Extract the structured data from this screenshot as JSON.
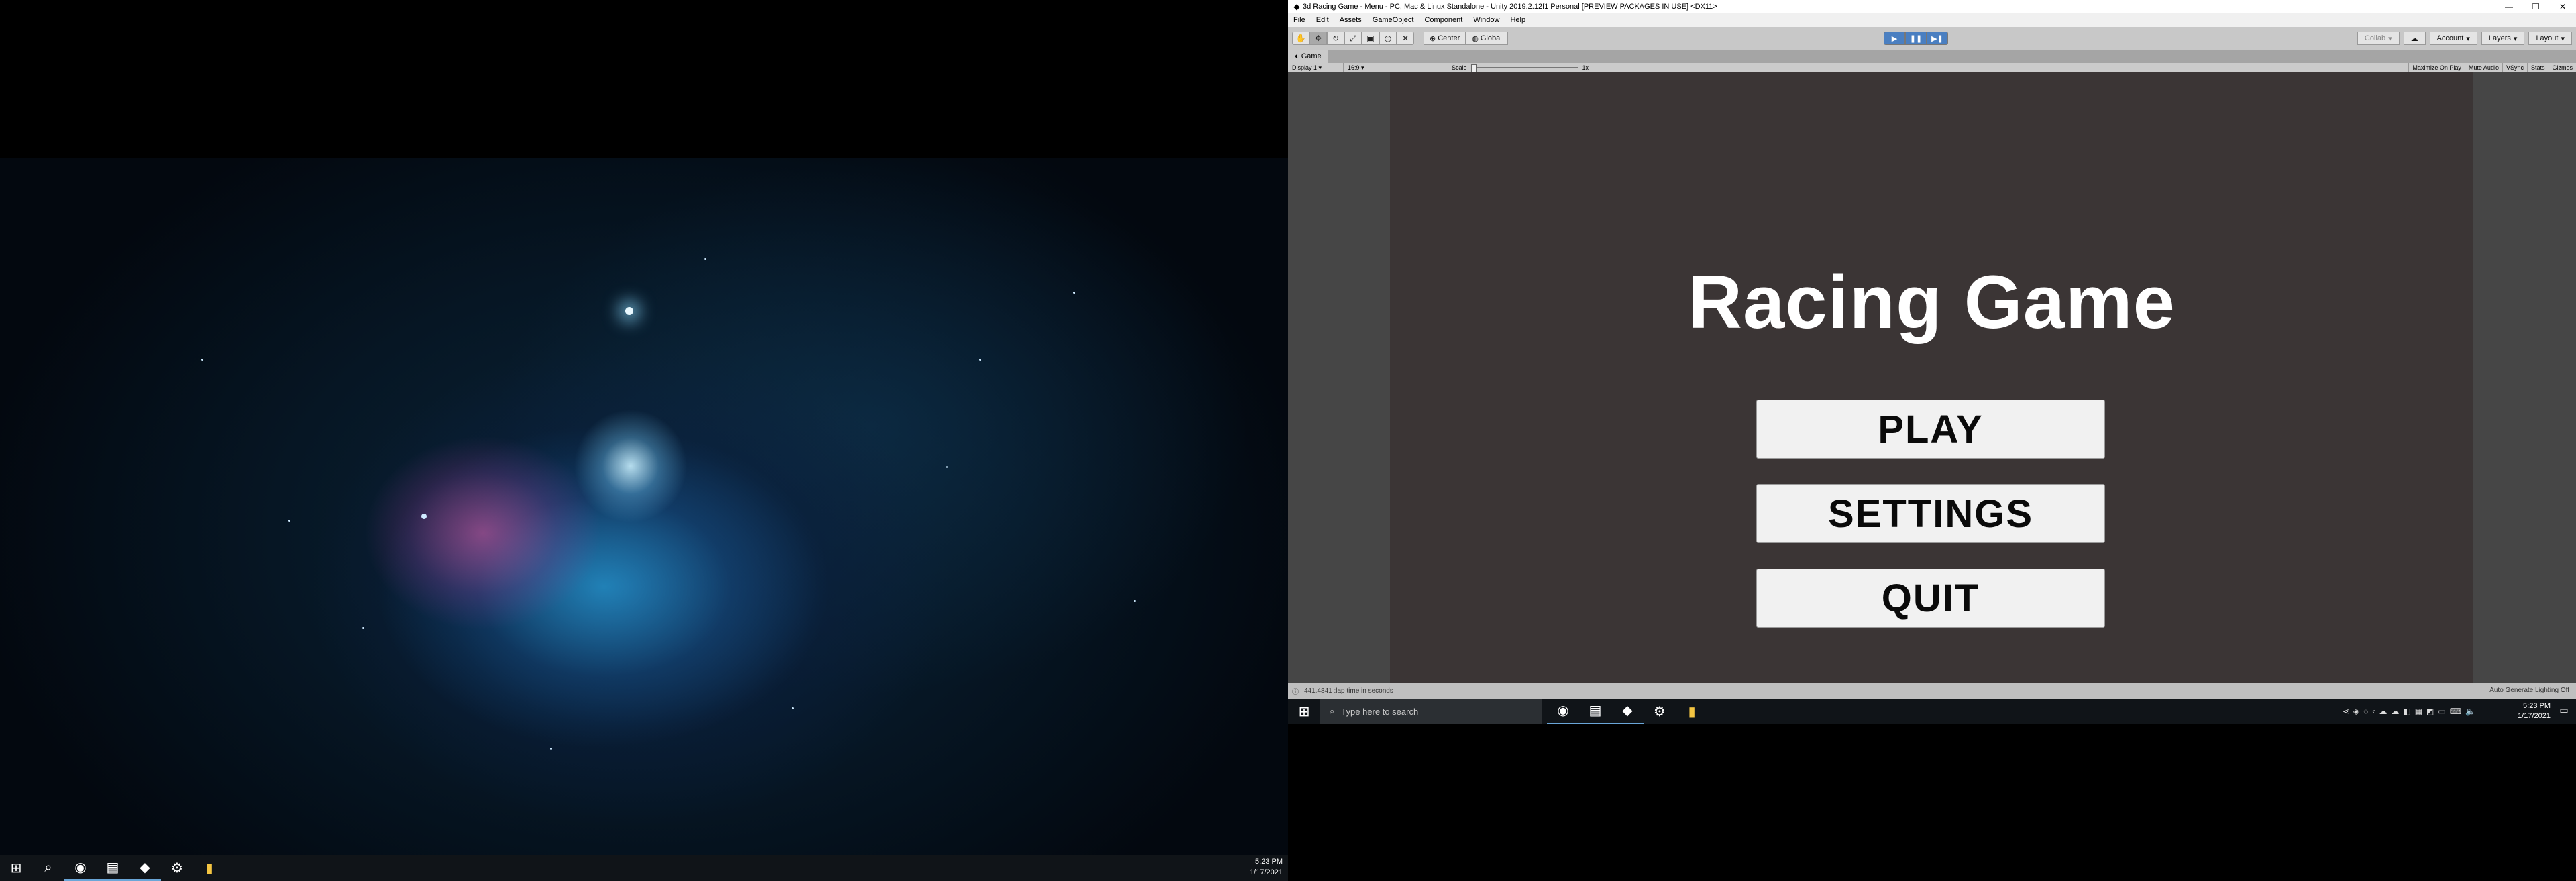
{
  "left_monitor": {
    "taskbar": {
      "apps": [
        {
          "icon": "windows-start-icon",
          "glyph": "⊞"
        },
        {
          "icon": "search-icon",
          "glyph": "⌕"
        },
        {
          "icon": "chrome-icon",
          "glyph": "◉"
        },
        {
          "icon": "file-explorer-icon",
          "glyph": "▤"
        },
        {
          "icon": "unity-icon",
          "glyph": "◆"
        },
        {
          "icon": "settings-gear-icon",
          "glyph": "⚙"
        },
        {
          "icon": "sticky-notes-icon",
          "glyph": "▮"
        }
      ],
      "clock_time": "5:23 PM",
      "clock_date": "1/17/2021"
    }
  },
  "unity": {
    "window_title": "3d Racing Game - Menu - PC, Mac & Linux Standalone - Unity 2019.2.12f1 Personal [PREVIEW PACKAGES IN USE] <DX11>",
    "menu": [
      "File",
      "Edit",
      "Assets",
      "GameObject",
      "Component",
      "Window",
      "Help"
    ],
    "toolbar": {
      "pivot_label": "Center",
      "space_label": "Global",
      "collab_label": "Collab",
      "account_label": "Account",
      "layers_label": "Layers",
      "layout_label": "Layout"
    },
    "game_tab": {
      "label": "Game",
      "display": "Display 1",
      "aspect": "16:9",
      "scale_label": "Scale",
      "scale_value": "1x",
      "toggles": [
        "Maximize On Play",
        "Mute Audio",
        "VSync",
        "Stats",
        "Gizmos"
      ]
    },
    "game": {
      "title": "Racing Game",
      "buttons": [
        "PLAY",
        "SETTINGS",
        "QUIT"
      ]
    },
    "status": {
      "message": "441.4841 :lap time in seconds",
      "right": "Auto Generate Lighting Off"
    }
  },
  "right_taskbar": {
    "search_placeholder": "Type here to search",
    "clock_time": "5:23 PM",
    "clock_date": "1/17/2021"
  }
}
